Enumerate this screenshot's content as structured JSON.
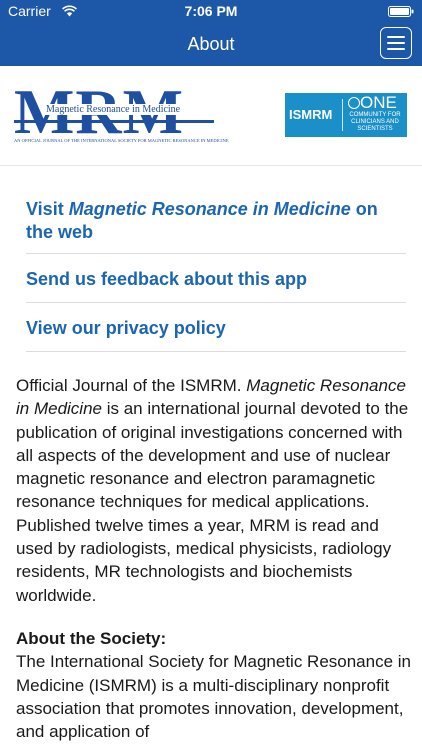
{
  "status_bar": {
    "carrier": "Carrier",
    "time": "7:06 PM"
  },
  "nav": {
    "title": "About",
    "menu_icon": "hamburger-menu-icon"
  },
  "logos": {
    "journal_abbrev": "MRM",
    "journal_name": "Magnetic Resonance in Medicine",
    "journal_tagline": "AN OFFICIAL JOURNAL OF THE INTERNATIONAL SOCIETY FOR MAGNETIC RESONANCE IN MEDICINE",
    "society_name": "ISMRM",
    "society_one": "ONE",
    "society_tagline": "COMMUNITY FOR CLINICIANS AND SCIENTISTS"
  },
  "links": {
    "visit_prefix": "Visit ",
    "visit_journal": "Magnetic Resonance in Medicine",
    "visit_suffix": " on the web",
    "feedback": "Send us feedback about this app",
    "privacy": "View our privacy policy"
  },
  "about": {
    "p1_start": "Official Journal of the ISMRM. ",
    "p1_journal": "Magnetic Resonance in Medicine",
    "p1_rest": " is an international journal devoted to the publication of original investigations concerned with all aspects of the development and use of nuclear magnetic resonance and electron paramagnetic resonance techniques for medical applications. Published twelve times a year, MRM is read and used by radiologists, medical physicists, radiology residents, MR technologists and biochemists worldwide.",
    "society_heading": "About the Society:",
    "society_text": "The International Society for Magnetic Resonance in Medicine (ISMRM) is a multi-disciplinary nonprofit association that promotes innovation, development, and application of"
  },
  "colors": {
    "nav_bar": "#1d57a8",
    "link": "#1b65b3",
    "brand": "#1f4fa0",
    "ismrm_blue": "#1b8fc8"
  }
}
